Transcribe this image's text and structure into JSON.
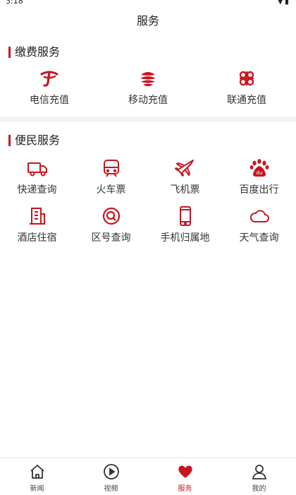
{
  "status_bar": {
    "time": "3:18",
    "right_icons": [
      "signal-icon",
      "battery-icon"
    ]
  },
  "header": {
    "title": "服务"
  },
  "sections": [
    {
      "title": "缴费服务",
      "items": [
        {
          "label": "电信充值",
          "icon": "china-telecom-icon"
        },
        {
          "label": "移动充值",
          "icon": "china-mobile-icon"
        },
        {
          "label": "联通充值",
          "icon": "china-unicom-icon"
        }
      ]
    },
    {
      "title": "便民服务",
      "items": [
        {
          "label": "快递查询",
          "icon": "delivery-truck-icon"
        },
        {
          "label": "火车票",
          "icon": "train-icon"
        },
        {
          "label": "飞机票",
          "icon": "airplane-icon"
        },
        {
          "label": "百度出行",
          "icon": "baidu-icon"
        },
        {
          "label": "酒店住宿",
          "icon": "hotel-building-icon"
        },
        {
          "label": "区号查询",
          "icon": "area-code-search-icon"
        },
        {
          "label": "手机归属地",
          "icon": "mobile-phone-icon"
        },
        {
          "label": "天气查询",
          "icon": "weather-cloud-icon"
        }
      ]
    }
  ],
  "bottom_nav": [
    {
      "label": "新闻",
      "icon": "home-icon",
      "active": false
    },
    {
      "label": "视频",
      "icon": "play-icon",
      "active": false
    },
    {
      "label": "服务",
      "icon": "heart-icon",
      "active": true
    },
    {
      "label": "我的",
      "icon": "user-icon",
      "active": false
    }
  ],
  "colors": {
    "accent": "#c8161e",
    "text": "#333333",
    "divider": "#f3f3f3"
  }
}
